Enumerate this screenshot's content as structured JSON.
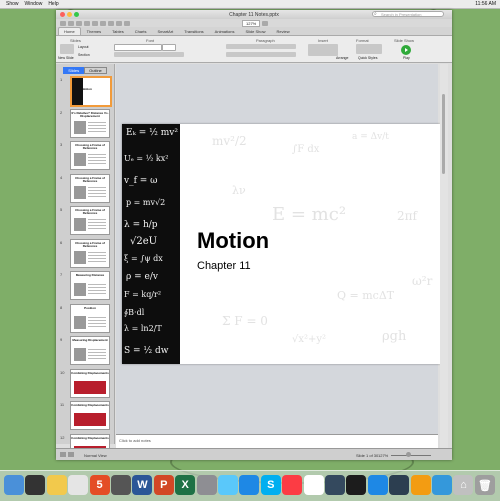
{
  "menubar": {
    "items": [
      "Show",
      "Window",
      "Help"
    ],
    "clock": "11:56 AM"
  },
  "window": {
    "title": "Chapter 11 Notes.pptx",
    "search_placeholder": "Search in Presentation",
    "zoom": "127%"
  },
  "ribbon": {
    "tabs": [
      "Home",
      "Themes",
      "Tables",
      "Charts",
      "SmartArt",
      "Transitions",
      "Animations",
      "Slide Show",
      "Review"
    ],
    "active_tab": "Home",
    "groups": [
      "Slides",
      "Font",
      "Paragraph",
      "Insert",
      "Format",
      "Slide Show"
    ],
    "buttons": [
      "New Slide",
      "Layout",
      "Section",
      "Arrange",
      "Quick Styles",
      "Play"
    ]
  },
  "left_pane": {
    "tabs": [
      "Slides",
      "Outline"
    ],
    "active_tab": "Slides",
    "thumbnails": [
      {
        "num": "1",
        "title": "Motion",
        "style": "title"
      },
      {
        "num": "2",
        "title": "It's Relative? Distance Vs. Displacement",
        "style": "text"
      },
      {
        "num": "3",
        "title": "Choosing a Frame of Reference",
        "style": "text"
      },
      {
        "num": "4",
        "title": "Choosing a Frame of Reference",
        "style": "text"
      },
      {
        "num": "5",
        "title": "Choosing a Frame of Reference",
        "style": "text"
      },
      {
        "num": "6",
        "title": "Choosing a Frame of Reference",
        "style": "text"
      },
      {
        "num": "7",
        "title": "Measuring Distance",
        "style": "text"
      },
      {
        "num": "8",
        "title": "Position",
        "style": "text"
      },
      {
        "num": "9",
        "title": "Measuring Displacement",
        "style": "text"
      },
      {
        "num": "10",
        "title": "Combining Displacements",
        "style": "red"
      },
      {
        "num": "11",
        "title": "Combining Displacements",
        "style": "red"
      },
      {
        "num": "12",
        "title": "Combining Displacements",
        "style": "red"
      }
    ]
  },
  "slide": {
    "title": "Motion",
    "subtitle": "Chapter 11"
  },
  "notes": {
    "placeholder": "Click to add notes"
  },
  "status": {
    "view": "Normal View",
    "slide_counter": "Slide 1 of 30",
    "zoom": "127%"
  },
  "dock": {
    "icons": [
      "finder-icon",
      "dashboard-icon",
      "stickies-icon",
      "chrome-icon",
      "html5-icon",
      "camera-icon",
      "word-icon",
      "powerpoint-icon",
      "excel-icon",
      "system-prefs-icon",
      "messages-icon",
      "app-store-icon",
      "skype-icon",
      "itunes-icon",
      "calendar-icon",
      "compass-icon",
      "quicktime-icon",
      "safari-icon",
      "audacity-icon",
      "photos-icon",
      "keynote-icon",
      "home-icon",
      "trash-icon"
    ]
  }
}
